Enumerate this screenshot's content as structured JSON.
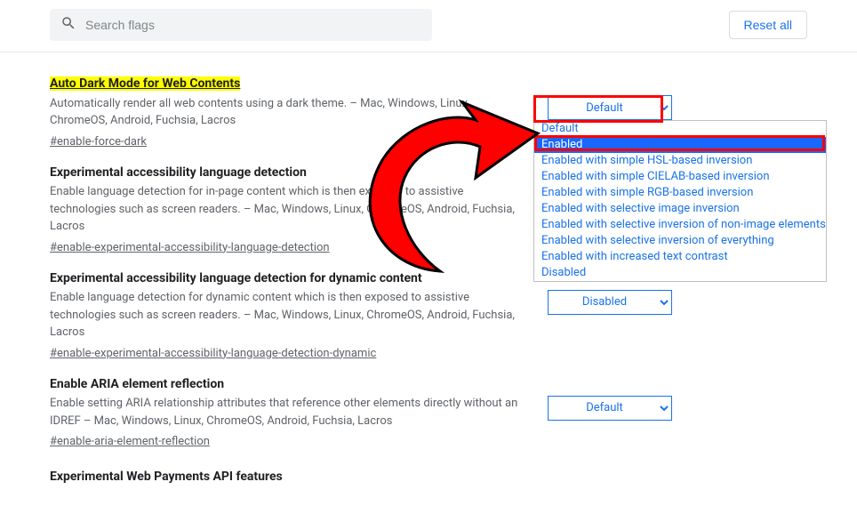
{
  "search": {
    "placeholder": "Search flags"
  },
  "reset_label": "Reset all",
  "flags": [
    {
      "title": "Auto Dark Mode for Web Contents",
      "desc": "Automatically render all web contents using a dark theme. – Mac, Windows, Linux, ChromeOS, Android, Fuchsia, Lacros",
      "hash": "#enable-force-dark",
      "selected": "Default"
    },
    {
      "title": "Experimental accessibility language detection",
      "desc": "Enable language detection for in-page content which is then exposed to assistive technologies such as screen readers. – Mac, Windows, Linux, ChromeOS, Android, Fuchsia, Lacros",
      "hash": "#enable-experimental-accessibility-language-detection",
      "selected": ""
    },
    {
      "title": "Experimental accessibility language detection for dynamic content",
      "desc": "Enable language detection for dynamic content which is then exposed to assistive technologies such as screen readers. – Mac, Windows, Linux, ChromeOS, Android, Fuchsia, Lacros",
      "hash": "#enable-experimental-accessibility-language-detection-dynamic",
      "selected": "Disabled"
    },
    {
      "title": "Enable ARIA element reflection",
      "desc": "Enable setting ARIA relationship attributes that reference other elements directly without an IDREF – Mac, Windows, Linux, ChromeOS, Android, Fuchsia, Lacros",
      "hash": "#enable-aria-element-reflection",
      "selected": "Default"
    }
  ],
  "partial_title": "Experimental Web Payments API features",
  "dropdown_options": [
    "Default",
    "Enabled",
    "Enabled with simple HSL-based inversion",
    "Enabled with simple CIELAB-based inversion",
    "Enabled with simple RGB-based inversion",
    "Enabled with selective image inversion",
    "Enabled with selective inversion of non-image elements",
    "Enabled with selective inversion of everything",
    "Enabled with increased text contrast",
    "Disabled"
  ],
  "dropdown_selected_index": 1
}
